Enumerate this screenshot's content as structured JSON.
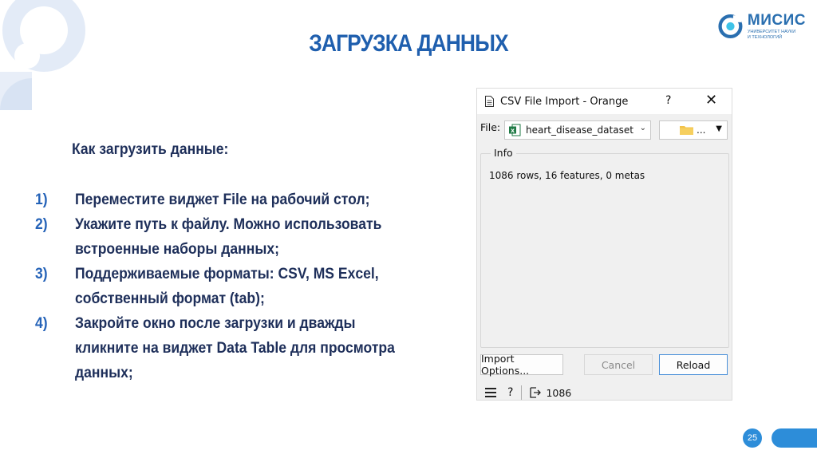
{
  "slide": {
    "title": "ЗАГРУЗКА ДАННЫХ",
    "intro": "Как загрузить данные:",
    "steps": [
      {
        "num": "1)",
        "text": "Переместите виджет File на рабочий стол;"
      },
      {
        "num": "2)",
        "text": "Укажите путь к файлу. Можно использовать встроенные наборы данных;"
      },
      {
        "num": "3)",
        "text": "Поддерживаемые форматы: CSV, MS Excel, собственный формат (tab);"
      },
      {
        "num": "4)",
        "text": "Закройте окно после загрузки и дважды кликните на виджет Data Table для просмотра данных;"
      }
    ],
    "page_number": "25"
  },
  "logo": {
    "main": "МИСИС",
    "sub": "УНИВЕРСИТЕТ НАУКИ И ТЕХНОЛОГИЙ"
  },
  "dialog": {
    "title": "CSV File Import - Orange",
    "help": "?",
    "close": "✕",
    "file_label": "File:",
    "file_name": "heart_disease_dataset.c",
    "browse_dots": "...",
    "info_title": "Info",
    "info_text": "1086 rows, 16 features, 0 metas",
    "buttons": {
      "import_options": "Import Options...",
      "cancel": "Cancel",
      "reload": "Reload"
    },
    "status": {
      "help": "?",
      "output_count": "1086"
    }
  },
  "colors": {
    "accent": "#2d8dd9",
    "title": "#1f5fae",
    "text": "#1e2f5a"
  }
}
